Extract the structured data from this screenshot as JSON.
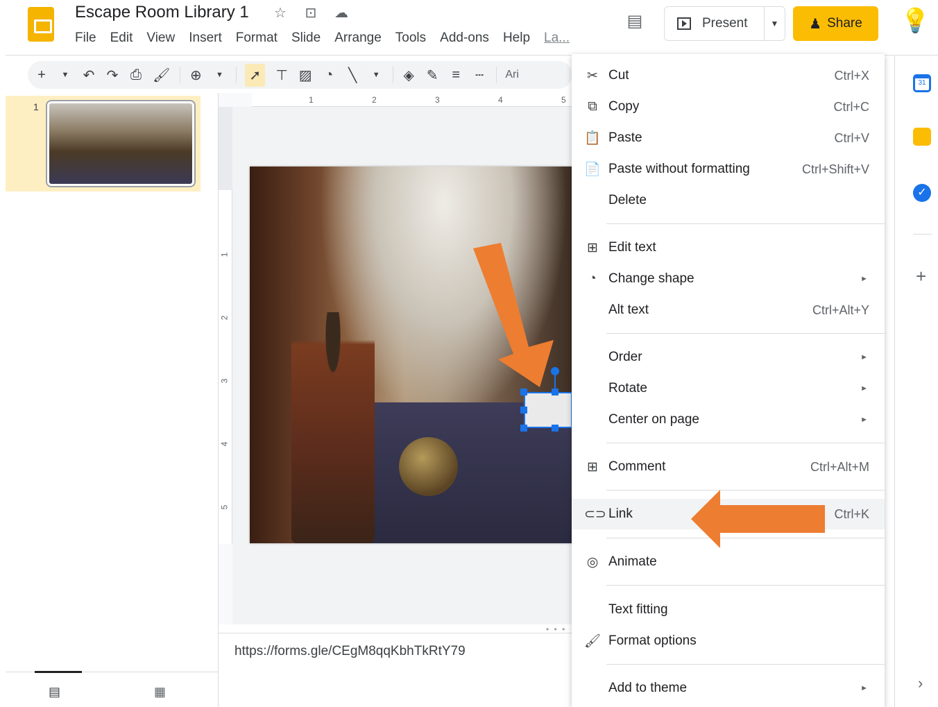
{
  "header": {
    "title": "Escape Room Library 1",
    "title_icons": [
      "star-icon",
      "move-to-folder-icon",
      "cloud-saved-icon"
    ],
    "menu": [
      "File",
      "Edit",
      "View",
      "Insert",
      "Format",
      "Slide",
      "Arrange",
      "Tools",
      "Add-ons",
      "Help",
      "La..."
    ],
    "present_label": "Present",
    "share_label": "Share"
  },
  "toolbar": {
    "font_partial": "Ari"
  },
  "ruler": {
    "h_ticks": [
      "1",
      "2",
      "3",
      "4",
      "5"
    ],
    "v_ticks": [
      "1",
      "2",
      "3",
      "4",
      "5"
    ]
  },
  "filmstrip": {
    "slides": [
      {
        "number": "1"
      }
    ]
  },
  "notes": {
    "text": "https://forms.gle/CEgM8qqKbhTkRtY79"
  },
  "context_menu": {
    "items": [
      {
        "label": "Cut",
        "shortcut": "Ctrl+X",
        "icon": "scissors-icon"
      },
      {
        "label": "Copy",
        "shortcut": "Ctrl+C",
        "icon": "copy-icon"
      },
      {
        "label": "Paste",
        "shortcut": "Ctrl+V",
        "icon": "clipboard-icon"
      },
      {
        "label": "Paste without formatting",
        "shortcut": "Ctrl+Shift+V",
        "icon": "paste-plain-icon"
      },
      {
        "label": "Delete",
        "shortcut": ""
      },
      {
        "label": "Edit text",
        "shortcut": "",
        "icon": "text-box-icon"
      },
      {
        "label": "Change shape",
        "shortcut": "",
        "icon": "shape-icon",
        "submenu": true
      },
      {
        "label": "Alt text",
        "shortcut": "Ctrl+Alt+Y"
      },
      {
        "label": "Order",
        "submenu": true
      },
      {
        "label": "Rotate",
        "submenu": true
      },
      {
        "label": "Center on page",
        "submenu": true
      },
      {
        "label": "Comment",
        "shortcut": "Ctrl+Alt+M",
        "icon": "add-comment-icon"
      },
      {
        "label": "Link",
        "shortcut": "Ctrl+K",
        "icon": "link-icon",
        "highlighted": true
      },
      {
        "label": "Animate",
        "shortcut": "",
        "icon": "animate-icon"
      },
      {
        "label": "Text fitting",
        "shortcut": ""
      },
      {
        "label": "Format options",
        "shortcut": "",
        "icon": "format-options-icon"
      },
      {
        "label": "Add to theme",
        "submenu": true
      }
    ]
  },
  "side_panel": {
    "calendar_day": "31"
  },
  "colors": {
    "accent_yellow": "#fbbc04",
    "annotation_arrow": "#ed7d31",
    "selection_blue": "#1a73e8"
  }
}
